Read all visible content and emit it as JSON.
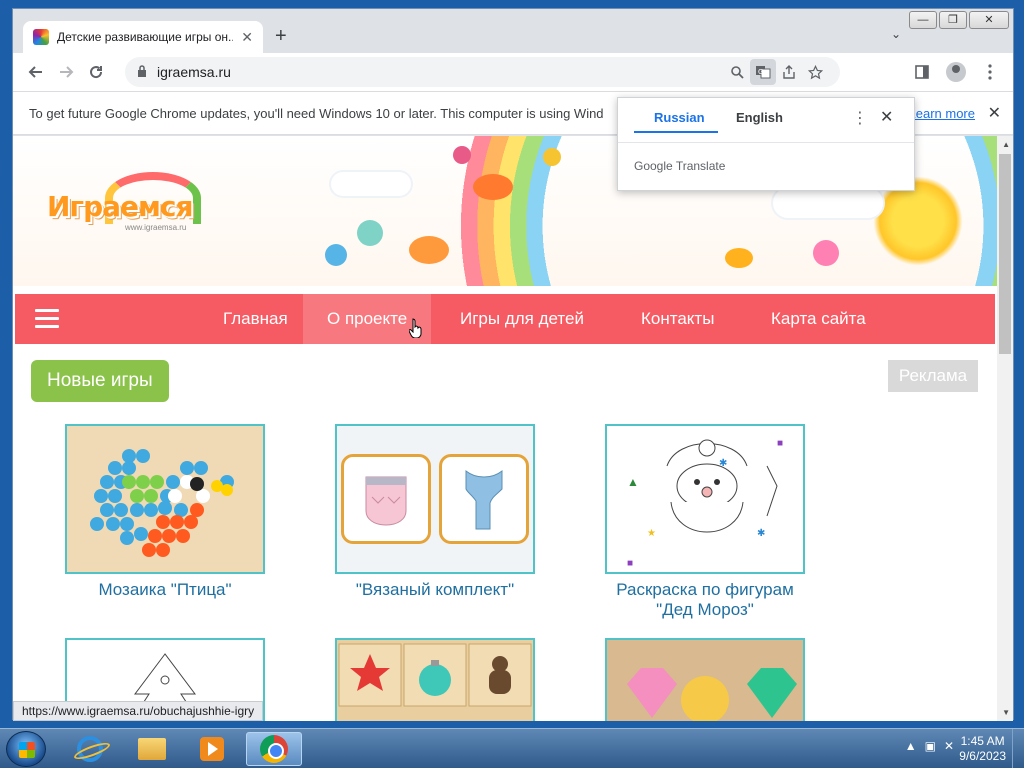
{
  "window": {
    "minimize": "—",
    "maximize": "❐",
    "close": "✕"
  },
  "tab": {
    "title": "Детские развивающие игры он...",
    "close": "✕",
    "new_tab": "+",
    "tab_search": "⌄"
  },
  "toolbar": {
    "url": "igraemsa.ru"
  },
  "infobar": {
    "message": "To get future Google Chrome updates, you'll need Windows 10 or later. This computer is using Wind",
    "link": "Learn more",
    "close": "✕"
  },
  "translate": {
    "tab_source": "Russian",
    "tab_target": "English",
    "brand": "Google Translate"
  },
  "site": {
    "logo": "Играемся",
    "logo_sub": "www.igraemsa.ru",
    "menu": [
      "Главная",
      "О проекте",
      "Игры для детей",
      "Контакты",
      "Карта сайта"
    ],
    "new_games": "Новые игры",
    "ad": "Реклама",
    "cards": [
      {
        "title": "Мозаика \"Птица\""
      },
      {
        "title": "\"Вязаный комплект\""
      },
      {
        "title": "Раскраска по фигурам \"Дед Мороз\""
      }
    ]
  },
  "status_url": "https://www.igraemsa.ru/obuchajushhie-igry",
  "taskbar": {
    "time": "1:45 AM",
    "date": "9/6/2023"
  },
  "colors": {
    "menu": "#f65b63",
    "menu_hover": "#f7787e",
    "new_games_button": "#8bc34a",
    "card_border": "#4fc3c8",
    "card_title": "#1f6fa0",
    "link": "#1a73e8"
  }
}
